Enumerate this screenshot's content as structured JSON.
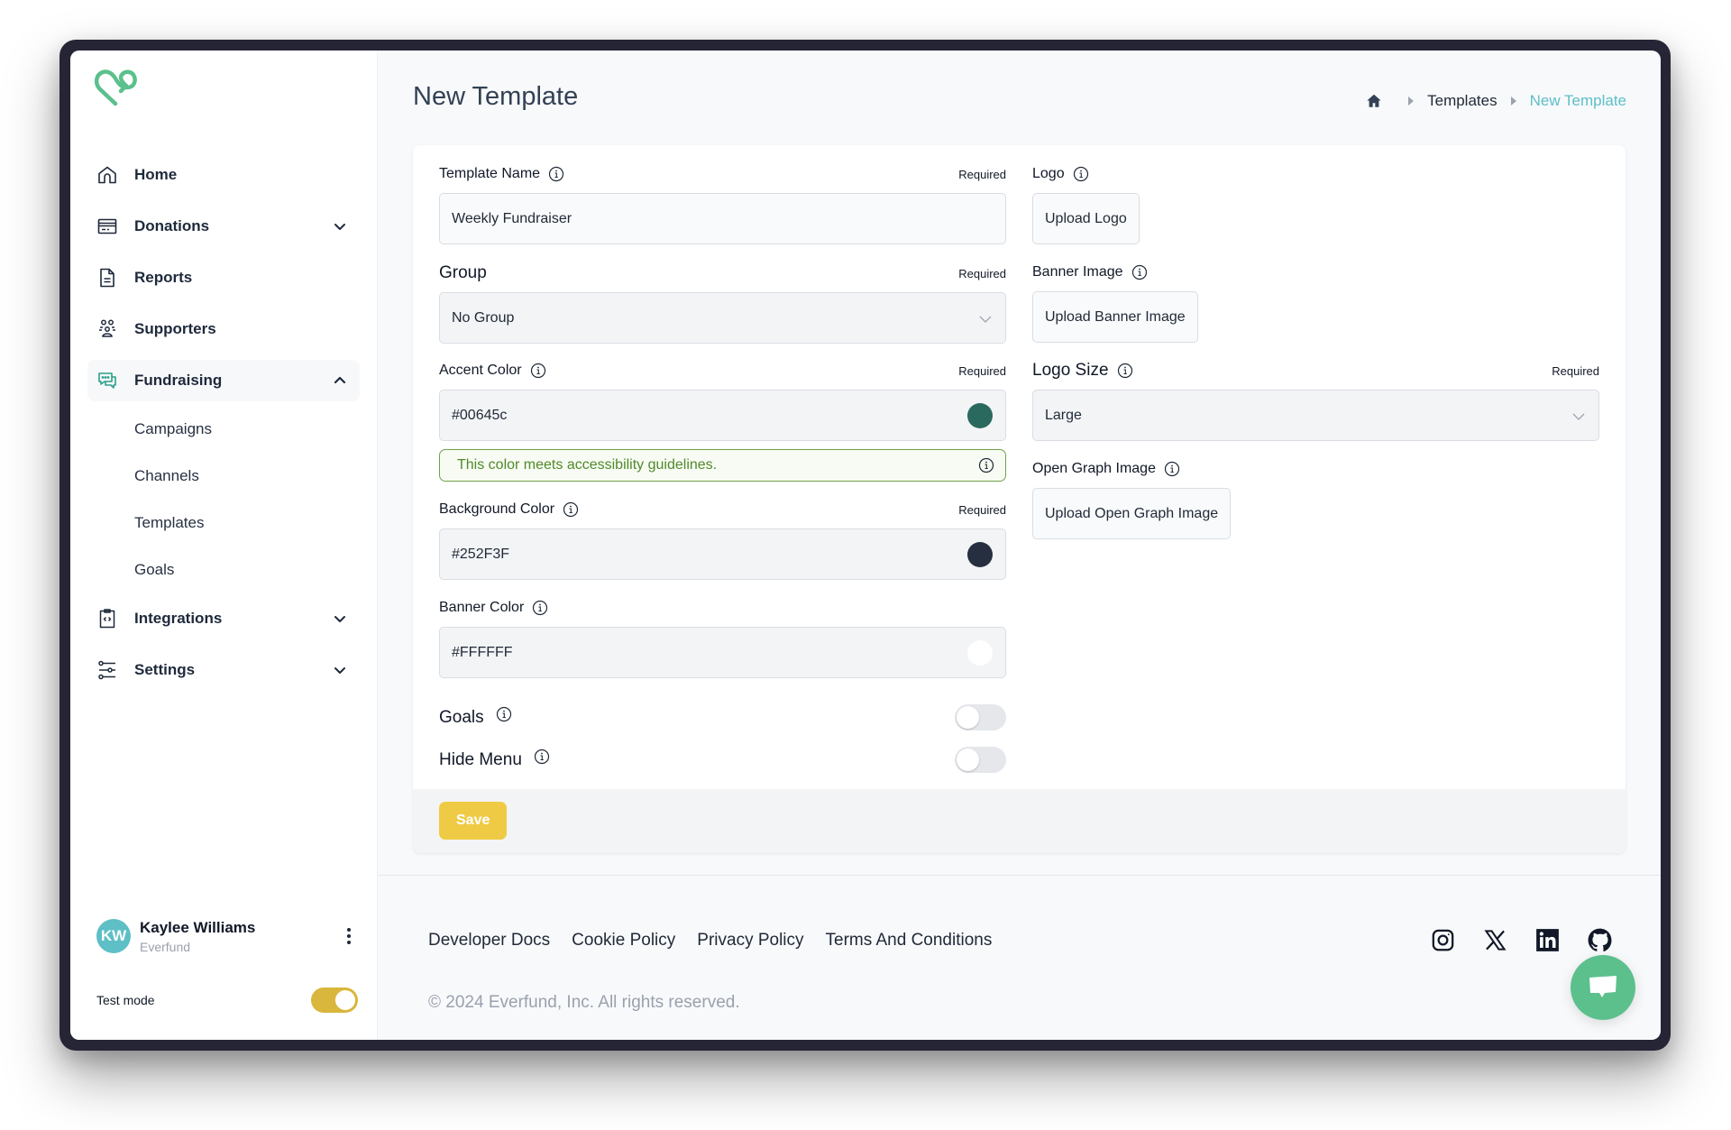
{
  "sidebar": {
    "logo_color": "#5bc08c",
    "items": [
      {
        "label": "Home",
        "icon": "home-icon"
      },
      {
        "label": "Donations",
        "icon": "credit-card-icon",
        "expandable": true
      },
      {
        "label": "Reports",
        "icon": "document-icon"
      },
      {
        "label": "Supporters",
        "icon": "users-icon"
      },
      {
        "label": "Fundraising",
        "icon": "chat-bubbles-icon",
        "expandable": true,
        "expanded": true,
        "active": true,
        "children": [
          "Campaigns",
          "Channels",
          "Templates",
          "Goals"
        ]
      },
      {
        "label": "Integrations",
        "icon": "clipboard-code-icon",
        "expandable": true
      },
      {
        "label": "Settings",
        "icon": "sliders-icon",
        "expandable": true
      }
    ],
    "user": {
      "initials": "KW",
      "name": "Kaylee Williams",
      "org": "Everfund"
    },
    "test_mode": {
      "label": "Test mode",
      "enabled": true
    }
  },
  "header": {
    "title": "New Template",
    "breadcrumb": [
      "Templates",
      "New Template"
    ]
  },
  "form": {
    "required_label": "Required",
    "template_name": {
      "label": "Template Name",
      "value": "Weekly Fundraiser"
    },
    "group": {
      "label": "Group",
      "value": "No Group"
    },
    "accent_color": {
      "label": "Accent Color",
      "value": "#00645c",
      "swatch": "#2a6a5e"
    },
    "accessibility_message": "This color meets accessibility guidelines.",
    "background_color": {
      "label": "Background Color",
      "value": "#252F3F",
      "swatch": "#252f3f"
    },
    "banner_color": {
      "label": "Banner Color",
      "value": "#FFFFFF",
      "swatch": "#ffffff"
    },
    "goals": {
      "label": "Goals",
      "enabled": false
    },
    "hide_menu": {
      "label": "Hide Menu",
      "enabled": false
    },
    "logo": {
      "label": "Logo",
      "button": "Upload Logo"
    },
    "banner_image": {
      "label": "Banner Image",
      "button": "Upload Banner Image"
    },
    "logo_size": {
      "label": "Logo Size",
      "value": "Large"
    },
    "open_graph": {
      "label": "Open Graph Image",
      "button": "Upload Open Graph Image"
    },
    "save_label": "Save"
  },
  "footer": {
    "links": [
      "Developer Docs",
      "Cookie Policy",
      "Privacy Policy",
      "Terms And Conditions"
    ],
    "copyright": "© 2024 Everfund, Inc. All rights reserved.",
    "socials": [
      "instagram-icon",
      "x-icon",
      "linkedin-icon",
      "github-icon"
    ]
  },
  "colors": {
    "brand_green": "#5bc08c",
    "breadcrumb_active": "#5ebfc6",
    "save_button": "#efcb45",
    "test_mode_toggle": "#d9b63c"
  }
}
